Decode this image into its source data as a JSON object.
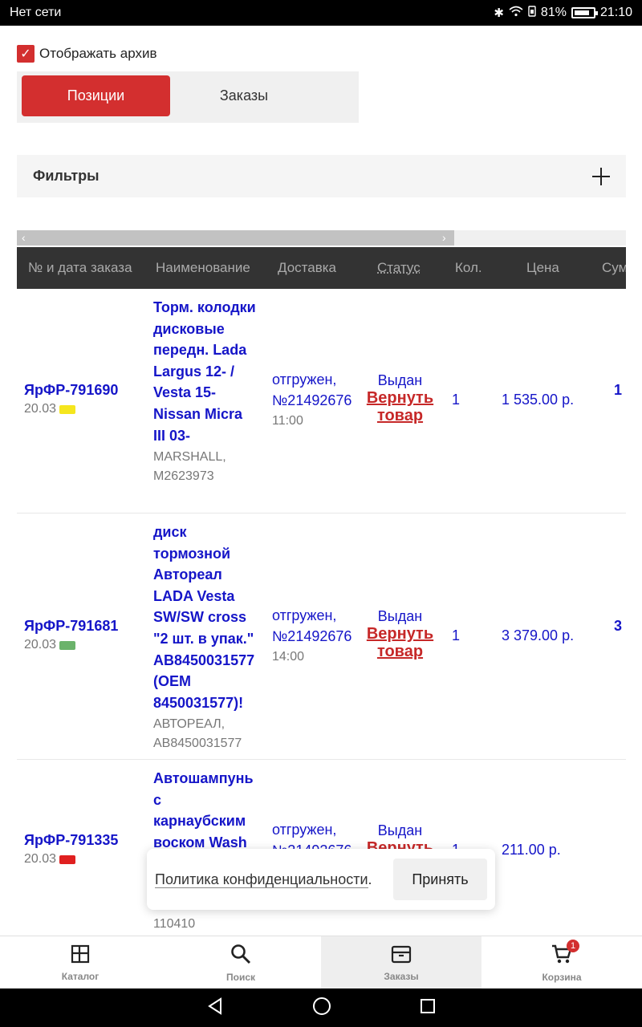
{
  "statusbar": {
    "network": "Нет сети",
    "battery": "81%",
    "time": "21:10",
    "battery_level": 0.81
  },
  "archive": {
    "label": "Отображать архив",
    "checked": true
  },
  "segment": {
    "positions": "Позиции",
    "orders": "Заказы"
  },
  "filters": {
    "label": "Фильтры"
  },
  "table": {
    "headers": [
      "№ и дата заказа",
      "Наименование",
      "Доставка",
      "Статус",
      "Кол.",
      "Цена",
      "Сум"
    ],
    "rows": [
      {
        "order": "ЯрФР-791690",
        "date": "20.03",
        "truck_color": "#f5e61e",
        "name": "Торм. колодки дисковые передн. Lada Largus 12- / Vesta 15- Nissan Micra III 03-",
        "brand": "MARSHALL, M2623973",
        "delivery": "отгружен, №21492676",
        "time": "11:00",
        "status": "Выдан",
        "return": "Вернуть товар",
        "qty": "1",
        "price": "1 535.00 р.",
        "sum": "1"
      },
      {
        "order": "ЯрФР-791681",
        "date": "20.03",
        "truck_color": "#6bb36b",
        "name": "диск тормозной Автореал LADA Vesta SW/SW cross \"2 шт. в упак.\" AB8450031577 (OEM 8450031577)!",
        "brand": "АВТОРЕАЛ, AB8450031577",
        "delivery": "отгружен, №21492676",
        "time": "14:00",
        "status": "Выдан",
        "return": "Вернуть товар",
        "qty": "1",
        "price": "3 379.00 р.",
        "sum": "3"
      },
      {
        "order": "ЯрФР-791335",
        "date": "20.03",
        "truck_color": "#e02020",
        "name": "Автошампунь с карнаубским воском Wash",
        "brand": "110410",
        "delivery": "отгружен, №21492676",
        "time": "",
        "status": "Выдан",
        "return": "Вернуть товар",
        "qty": "1",
        "price": "211.00 р.",
        "sum": ""
      }
    ]
  },
  "popup": {
    "text": "Политика конфиденциальности",
    "dot": ".",
    "accept": "Принять"
  },
  "bottomnav": {
    "items": [
      {
        "label": "Каталог",
        "icon": "catalog-icon"
      },
      {
        "label": "Поиск",
        "icon": "search-icon"
      },
      {
        "label": "Заказы",
        "icon": "orders-box-icon"
      },
      {
        "label": "Корзина",
        "icon": "cart-icon"
      }
    ],
    "active": "Заказы",
    "cart_badge": "1"
  },
  "colors": {
    "accent": "#d32f2f",
    "link": "#1515c8",
    "header_bg": "#333333"
  }
}
